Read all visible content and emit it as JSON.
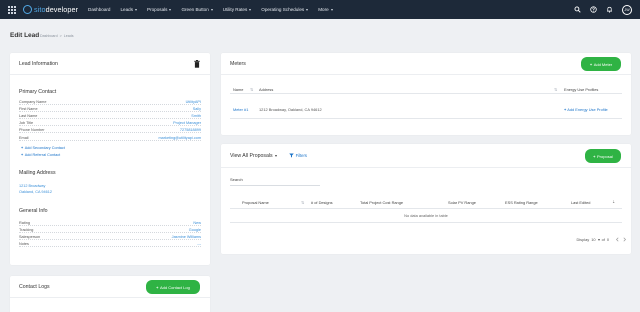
{
  "nav": {
    "logo_prefix": "sito",
    "logo_suffix": "developer",
    "items": [
      {
        "label": "Dashboard",
        "dropdown": false
      },
      {
        "label": "Leads",
        "dropdown": true
      },
      {
        "label": "Proposals",
        "dropdown": true
      },
      {
        "label": "Green Button",
        "dropdown": true
      },
      {
        "label": "Utility Rates",
        "dropdown": true
      },
      {
        "label": "Operating Schedules",
        "dropdown": true
      },
      {
        "label": "More",
        "dropdown": true
      }
    ],
    "avatar_initials": "JW"
  },
  "page": {
    "title": "Edit Lead",
    "breadcrumb": [
      "Dashboard",
      ">",
      "Leads"
    ]
  },
  "lead_info": {
    "title": "Lead Information",
    "primary_contact_title": "Primary Contact",
    "fields": [
      {
        "label": "Company Name",
        "value": "UtilityAPI"
      },
      {
        "label": "First Name",
        "value": "Sally"
      },
      {
        "label": "Last Name",
        "value": "Smith"
      },
      {
        "label": "Job Title",
        "value": "Project Manager"
      },
      {
        "label": "Phone Number",
        "value": "7275818899"
      },
      {
        "label": "Email",
        "value": "marketing@utilityapi.com"
      }
    ],
    "add_secondary": "Add Secondary Contact",
    "add_referral": "Add Referral Contact",
    "mailing_title": "Mailing Address",
    "address_line1": "1212 Broadway",
    "address_line2": "Oakland, CA 94612",
    "general_title": "General Info",
    "general_fields": [
      {
        "label": "Rating",
        "value": "New"
      },
      {
        "label": "Tracking",
        "value": "Google"
      },
      {
        "label": "Salesperson",
        "value": "Jasmine Williams"
      },
      {
        "label": "Notes",
        "value": "---"
      }
    ]
  },
  "contact_logs": {
    "title": "Contact Logs",
    "add_button": "Add Contact Log"
  },
  "meters": {
    "title": "Meters",
    "add_button": "Add Meter",
    "columns": [
      "Name",
      "Address",
      "Energy Use Profiles"
    ],
    "rows": [
      {
        "name": "Meter #1",
        "address": "1212 Broadway, Oakland, CA 94612",
        "action": "Add Energy Use Profile"
      }
    ]
  },
  "proposals": {
    "view_label": "View All Proposals",
    "filters_label": "Filters",
    "add_button": "Proposal",
    "search_label": "Search",
    "search_value": "",
    "columns": [
      "Proposal Name",
      "# of Designs",
      "Total Project Cost Range",
      "Solar PV Range",
      "ESS Rating Range",
      "Last Edited"
    ],
    "empty_text": "No data available in table",
    "display_label": "Display",
    "display_value": "10",
    "of_label": "of",
    "pages_value": "0"
  },
  "colors": {
    "nav_bg": "#1d2939",
    "accent_green": "#2fb344",
    "link_blue": "#1a73c9",
    "value_blue": "#3a8fd8"
  }
}
